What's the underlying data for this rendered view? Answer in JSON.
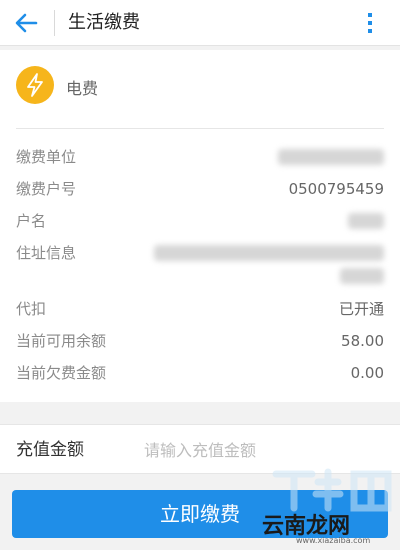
{
  "colors": {
    "accent": "#1f8ee8",
    "bolt": "#f6b51b"
  },
  "appbar": {
    "back_icon": "arrow-left-icon",
    "title": "生活缴费",
    "more_icon": "more-vertical-icon"
  },
  "bill": {
    "icon": "lightning-bolt-icon",
    "name": "电费",
    "rows": [
      {
        "label": "缴费单位",
        "value": ""
      },
      {
        "label": "缴费户号",
        "value": "0500795459"
      },
      {
        "label": "户名",
        "value": ""
      },
      {
        "label": "住址信息",
        "value": ""
      },
      {
        "label": "代扣",
        "value": "已开通"
      },
      {
        "label": "当前可用余额",
        "value": "58.00"
      },
      {
        "label": "当前欠费金额",
        "value": "0.00"
      }
    ]
  },
  "recharge": {
    "label": "充值金额",
    "placeholder": "请输入充值金额",
    "value": ""
  },
  "pay_button": {
    "label": "立即缴费"
  },
  "watermark": {
    "text": "云南龙网",
    "url": "www.xiazaiba.com"
  }
}
